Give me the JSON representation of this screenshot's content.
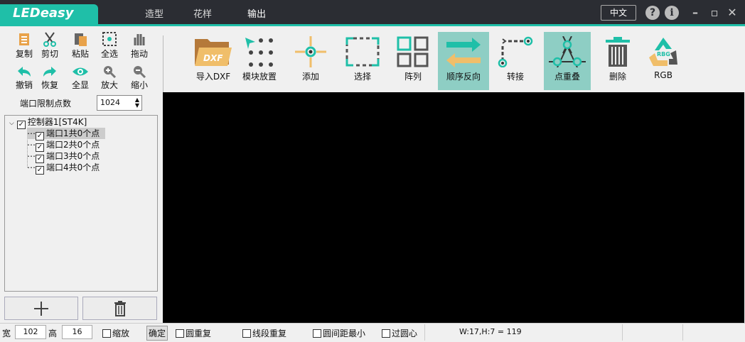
{
  "app": {
    "logo": "LEDeasy"
  },
  "menu": [
    "造型",
    "花样",
    "输出"
  ],
  "title_controls": {
    "language": "中文",
    "help": "?",
    "info": "i",
    "minimize": "–",
    "restore": "▫",
    "close": "✕"
  },
  "left_tools": {
    "row1": [
      "复制",
      "剪切",
      "粘贴",
      "全选",
      "拖动"
    ],
    "row2": [
      "撤销",
      "恢复",
      "全显",
      "放大",
      "缩小"
    ]
  },
  "port_limit": {
    "label": "端口限制点数",
    "value": "1024"
  },
  "toolbar": [
    "导入DXF",
    "模块放置",
    "添加",
    "选择",
    "阵列",
    "顺序反向",
    "转接",
    "点重叠",
    "删除",
    "RGB"
  ],
  "tree": {
    "root": "控制器1[ST4K]",
    "children": [
      "端口1共0个点",
      "端口2共0个点",
      "端口3共0个点",
      "端口4共0个点"
    ]
  },
  "status": {
    "width_label": "宽",
    "width_value": "102",
    "height_label": "高",
    "height_value": "16",
    "scale": "缩放",
    "confirm": "确定",
    "circle_repeat": "圆重复",
    "segment_repeat": "线段重复",
    "min_circle_gap": "圆间距最小",
    "through_center": "过圆心",
    "readout": "W:17,H:7 = 119"
  },
  "colors": {
    "accent": "#1fbfa8",
    "highlight": "#8ecec4",
    "titlebar": "#2b2d33"
  }
}
